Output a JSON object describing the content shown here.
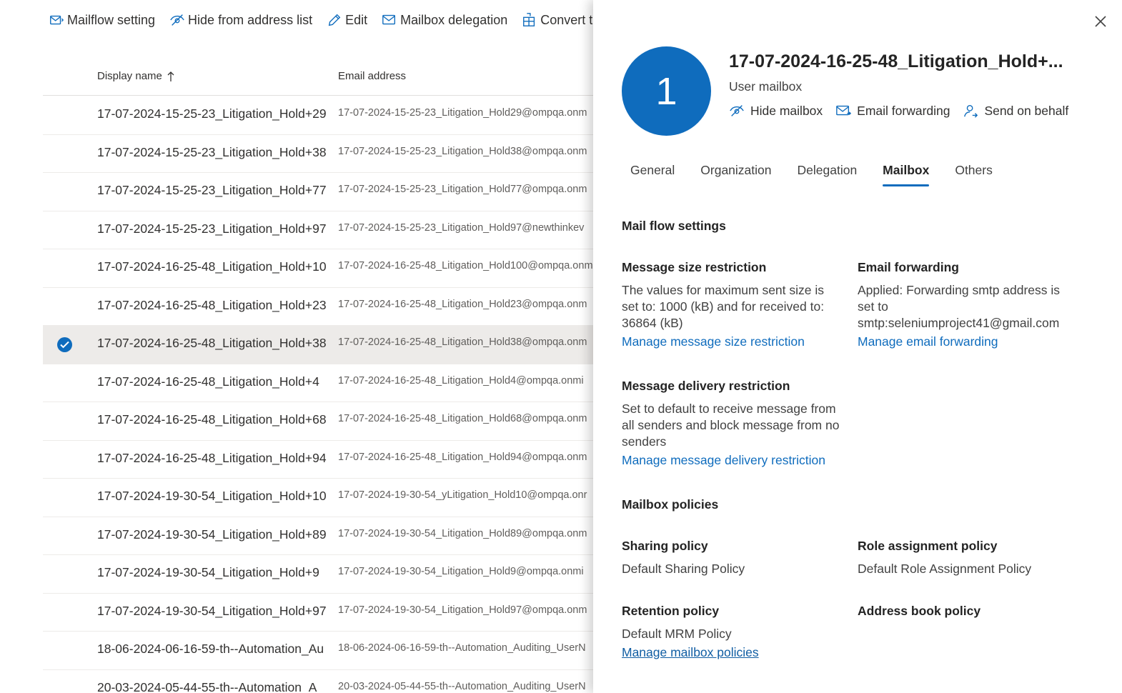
{
  "toolbar": {
    "items": [
      {
        "label": "Mailflow setting",
        "icon": "mailflow-icon"
      },
      {
        "label": "Hide from address list",
        "icon": "hide-eye-icon"
      },
      {
        "label": "Edit",
        "icon": "pencil-icon"
      },
      {
        "label": "Mailbox delegation",
        "icon": "mail-delegation-icon"
      },
      {
        "label": "Convert t",
        "icon": "convert-icon"
      }
    ]
  },
  "list": {
    "headers": {
      "display_name": "Display name",
      "email": "Email address"
    },
    "sort_icon": "arrow-up-icon",
    "rows": [
      {
        "name": "17-07-2024-15-25-23_Litigation_Hold+29",
        "email": "17-07-2024-15-25-23_Litigation_Hold29@ompqa.onm",
        "selected": false
      },
      {
        "name": "17-07-2024-15-25-23_Litigation_Hold+38",
        "email": "17-07-2024-15-25-23_Litigation_Hold38@ompqa.onm",
        "selected": false
      },
      {
        "name": "17-07-2024-15-25-23_Litigation_Hold+77",
        "email": "17-07-2024-15-25-23_Litigation_Hold77@ompqa.onm",
        "selected": false
      },
      {
        "name": "17-07-2024-15-25-23_Litigation_Hold+97",
        "email": "17-07-2024-15-25-23_Litigation_Hold97@newthinkev",
        "selected": false
      },
      {
        "name": "17-07-2024-16-25-48_Litigation_Hold+10",
        "email": "17-07-2024-16-25-48_Litigation_Hold100@ompqa.onm",
        "selected": false
      },
      {
        "name": "17-07-2024-16-25-48_Litigation_Hold+23",
        "email": "17-07-2024-16-25-48_Litigation_Hold23@ompqa.onm",
        "selected": false
      },
      {
        "name": "17-07-2024-16-25-48_Litigation_Hold+38",
        "email": "17-07-2024-16-25-48_Litigation_Hold38@ompqa.onm",
        "selected": true
      },
      {
        "name": "17-07-2024-16-25-48_Litigation_Hold+4",
        "email": "17-07-2024-16-25-48_Litigation_Hold4@ompqa.onmi",
        "selected": false
      },
      {
        "name": "17-07-2024-16-25-48_Litigation_Hold+68",
        "email": "17-07-2024-16-25-48_Litigation_Hold68@ompqa.onm",
        "selected": false
      },
      {
        "name": "17-07-2024-16-25-48_Litigation_Hold+94",
        "email": "17-07-2024-16-25-48_Litigation_Hold94@ompqa.onm",
        "selected": false
      },
      {
        "name": "17-07-2024-19-30-54_Litigation_Hold+10",
        "email": "17-07-2024-19-30-54_yLitigation_Hold10@ompqa.onr",
        "selected": false
      },
      {
        "name": "17-07-2024-19-30-54_Litigation_Hold+89",
        "email": "17-07-2024-19-30-54_Litigation_Hold89@ompqa.onm",
        "selected": false
      },
      {
        "name": "17-07-2024-19-30-54_Litigation_Hold+9",
        "email": "17-07-2024-19-30-54_Litigation_Hold9@ompqa.onmi",
        "selected": false
      },
      {
        "name": "17-07-2024-19-30-54_Litigation_Hold+97",
        "email": "17-07-2024-19-30-54_Litigation_Hold97@ompqa.onm",
        "selected": false
      },
      {
        "name": "18-06-2024-06-16-59-th--Automation_Au",
        "email": "18-06-2024-06-16-59-th--Automation_Auditing_UserN",
        "selected": false
      },
      {
        "name": "20-03-2024-05-44-55-th--Automation_A",
        "email": "20-03-2024-05-44-55-th--Automation_Auditing_UserN",
        "selected": false
      }
    ]
  },
  "panel": {
    "avatar_initial": "1",
    "title": "17-07-2024-16-25-48_Litigation_Hold+...",
    "subtitle": "User mailbox",
    "actions": [
      {
        "label": "Hide mailbox",
        "icon": "hide-eye-icon"
      },
      {
        "label": "Email forwarding",
        "icon": "mail-forward-icon"
      },
      {
        "label": "Send on behalf",
        "icon": "person-icon"
      }
    ],
    "tabs": [
      "General",
      "Organization",
      "Delegation",
      "Mailbox",
      "Others"
    ],
    "active_tab": "Mailbox",
    "mail_flow": {
      "title": "Mail flow settings",
      "size": {
        "label": "Message size restriction",
        "text": "The values for maximum sent size is set to: 1000 (kB) and for received to: 36864 (kB)",
        "link": "Manage message size restriction"
      },
      "forwarding": {
        "label": "Email forwarding",
        "text": "Applied: Forwarding smtp address is set to smtp:seleniumproject41@gmail.com",
        "link": "Manage email forwarding"
      },
      "delivery": {
        "label": "Message delivery restriction",
        "text": "Set to default to receive message from all senders and block message from no senders",
        "link": "Manage message delivery restriction"
      }
    },
    "policies": {
      "title": "Mailbox policies",
      "sharing": {
        "label": "Sharing policy",
        "value": "Default Sharing Policy"
      },
      "role": {
        "label": "Role assignment policy",
        "value": "Default Role Assignment Policy"
      },
      "retention": {
        "label": "Retention policy",
        "value": "Default MRM Policy"
      },
      "address_book": {
        "label": "Address book policy",
        "value": ""
      },
      "manage_link": "Manage mailbox policies"
    }
  },
  "colors": {
    "accent": "#0f6cbd",
    "selected_row": "#edebe9"
  }
}
